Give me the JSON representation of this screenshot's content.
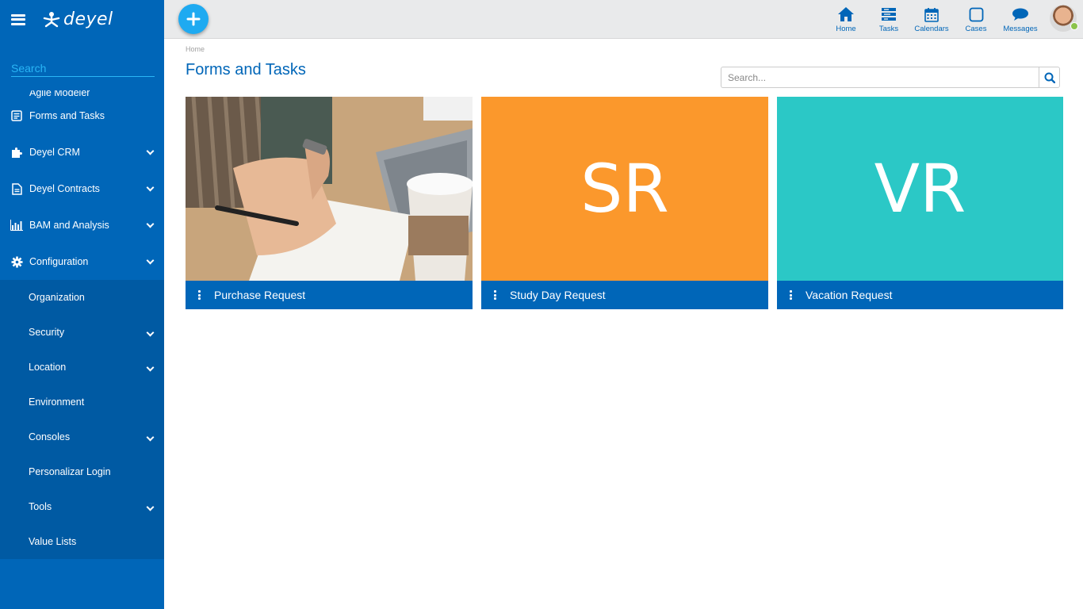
{
  "sidebar": {
    "logo_text": "deyel",
    "search_placeholder": "Search",
    "partial_item": "Agile Modeler",
    "items": [
      {
        "label": "Forms and Tasks",
        "icon": "form-icon"
      },
      {
        "label": "Deyel CRM",
        "icon": "puzzle-icon"
      },
      {
        "label": "Deyel Contracts",
        "icon": "document-icon"
      },
      {
        "label": "BAM and Analysis",
        "icon": "bar-chart-icon"
      },
      {
        "label": "Configuration",
        "icon": "gear-icon"
      }
    ],
    "subitems": [
      {
        "label": "Organization"
      },
      {
        "label": "Security"
      },
      {
        "label": "Location"
      },
      {
        "label": "Environment"
      },
      {
        "label": "Consoles"
      },
      {
        "label": "Personalizar Login"
      },
      {
        "label": "Tools"
      },
      {
        "label": "Value Lists"
      }
    ]
  },
  "topbar": {
    "nav": [
      {
        "label": "Home",
        "icon": "home-icon"
      },
      {
        "label": "Tasks",
        "icon": "tasks-icon"
      },
      {
        "label": "Calendars",
        "icon": "calendar-icon"
      },
      {
        "label": "Cases",
        "icon": "cases-icon"
      },
      {
        "label": "Messages",
        "icon": "chat-icon"
      }
    ]
  },
  "main": {
    "breadcrumb": "Home",
    "title": "Forms and Tasks",
    "search_placeholder": "Search...",
    "cards": [
      {
        "label": "Purchase Request",
        "initials": "",
        "color": "#ffffff"
      },
      {
        "label": "Study Day Request",
        "initials": "SR",
        "color": "#fb982c"
      },
      {
        "label": "Vacation Request",
        "initials": "VR",
        "color": "#2bc8c6"
      }
    ]
  },
  "colors": {
    "primary": "#0066b8",
    "accent": "#1eaaf1"
  }
}
